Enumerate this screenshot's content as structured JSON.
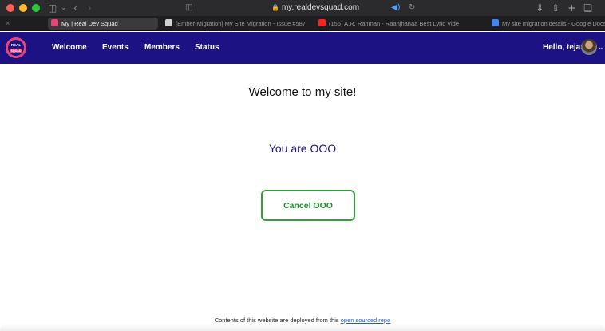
{
  "browser": {
    "url": "my.realdevsquad.com",
    "tabs": [
      {
        "label": "My | Real Dev Squad",
        "active": true
      },
      {
        "label": "[Ember-Migration] My Site Migration - Issue #587 · Real-D...",
        "active": false
      },
      {
        "label": "(156) A.R. Rahman - Raanjhanaa Best Lyric Video|Sona...",
        "active": false
      },
      {
        "label": "My site migration details - Google Docs",
        "active": false
      }
    ]
  },
  "navbar": {
    "logo_text": "Real Dev Squad",
    "links": [
      "Welcome",
      "Events",
      "Members",
      "Status"
    ],
    "greeting": "Hello, tejas!"
  },
  "main": {
    "welcome_text": "Welcome to my site!",
    "ooo_status": "You are OOO",
    "cancel_button": "Cancel OOO"
  },
  "footer": {
    "text": "Contents of this website are deployed from this",
    "link_text": "open sourced repo"
  },
  "colors": {
    "navbar": "#1d1283",
    "ooo_text": "#1d1283",
    "button_border": "#2ea03a"
  }
}
